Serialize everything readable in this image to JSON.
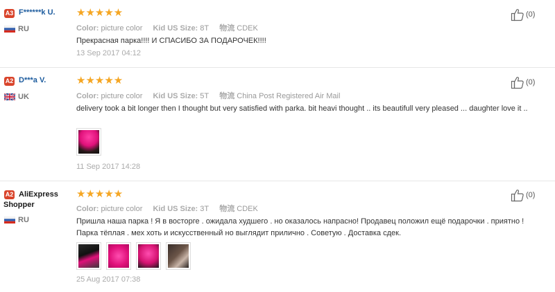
{
  "reviews": [
    {
      "badge": "A3",
      "name": "F******k U.",
      "country": "RU",
      "stars": "★★★★★",
      "color_label": "Color:",
      "color_value": "picture color",
      "size_label": "Kid US Size:",
      "size_value": "8T",
      "ship_label": "物流",
      "ship_value": "CDEK",
      "text": "Прекрасная парка!!!! И СПАСИБО ЗА ПОДАРОЧЕК!!!!",
      "date": "13 Sep 2017 04:12",
      "likes": "(0)"
    },
    {
      "badge": "A2",
      "name": "D***a V.",
      "country": "UK",
      "stars": "★★★★★",
      "color_label": "Color:",
      "color_value": "picture color",
      "size_label": "Kid US Size:",
      "size_value": "5T",
      "ship_label": "物流",
      "ship_value": "China Post Registered Air Mail",
      "text": "delivery took a bit longer then I thought but very satisfied with parka. bit heavi thought .. its beautifull very pleased ... daughter love it ..",
      "date": "11 Sep 2017 14:28",
      "likes": "(0)"
    },
    {
      "badge": "A2",
      "name": "AliExpress Shopper",
      "country": "RU",
      "stars": "★★★★★",
      "color_label": "Color:",
      "color_value": "picture color",
      "size_label": "Kid US Size:",
      "size_value": "3T",
      "ship_label": "物流",
      "ship_value": "CDEK",
      "text": "Пришла наша парка ! Я в восторге . ожидала худшего . но оказалось напрасно! Продавец положил ещё подарочки . приятно ! Парка тёплая . мех хоть и искусственный но выглядит прилично . Советую . Доставка сдек.",
      "date": "25 Aug 2017 07:38",
      "likes": "(0)"
    }
  ],
  "colors": {
    "star": "#f5a623",
    "badge": "#d9442b",
    "name_link": "#1d5c9e"
  }
}
